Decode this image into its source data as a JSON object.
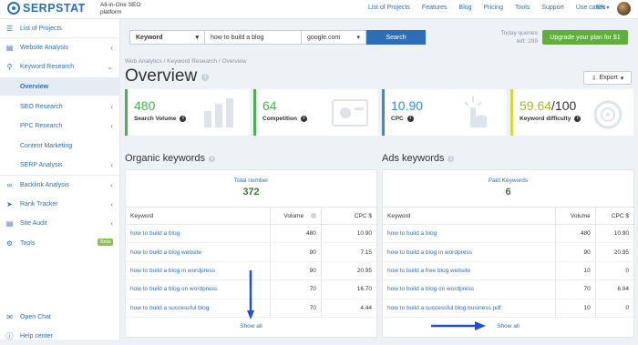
{
  "header": {
    "brand": "SERPSTAT",
    "tagline": "All-in-One SEO platform",
    "nav": [
      "List of Projects",
      "Features",
      "Blog",
      "Pricing",
      "Tools",
      "Support",
      "Use cases"
    ],
    "lang": "EN"
  },
  "sidebar": {
    "items": [
      {
        "label": "List of Projects",
        "icon": "list-icon"
      },
      {
        "label": "Website Analysis",
        "icon": "chart-icon"
      },
      {
        "label": "Keyword Research",
        "icon": "key-icon"
      },
      {
        "label": "Overview"
      },
      {
        "label": "SEO Research"
      },
      {
        "label": "PPC Research"
      },
      {
        "label": "Content Marketing"
      },
      {
        "label": "SERP Analysis"
      },
      {
        "label": "Backlink Analysis",
        "icon": "link-icon"
      },
      {
        "label": "Rank Tracker",
        "icon": "tracker-icon"
      },
      {
        "label": "Site Audit",
        "icon": "audit-icon"
      },
      {
        "label": "Tools",
        "icon": "gear-icon"
      }
    ],
    "beta": "Beta",
    "open_chat": "Open Chat",
    "help_center": "Help center"
  },
  "search": {
    "type": "Keyword",
    "query": "how to build a blog",
    "engine": "google.com",
    "button": "Search",
    "queries_label": "Today queries",
    "queries_left": "left: 299",
    "upgrade": "Upgrade your plan for $1"
  },
  "page": {
    "breadcrumb": "Web Analytics / Keyword Research / Overview",
    "title": "Overview",
    "export": "Export"
  },
  "cards": [
    {
      "value": "480",
      "label": "Search Volume",
      "color": "#4caf50"
    },
    {
      "value": "64",
      "label": "Competition",
      "color": "#4caf50"
    },
    {
      "value": "10.90",
      "label": "CPC",
      "color": "#2d8fd5"
    },
    {
      "value_main": "59.64",
      "value_tail": "/100",
      "label": "Keyword difficulty",
      "color": "#cddc39"
    }
  ],
  "organic": {
    "title": "Organic keywords",
    "total_label": "Total number",
    "total_value": "372",
    "columns": [
      "Keyword",
      "Volume",
      "CPC $"
    ],
    "rows": [
      [
        "how to build a blog",
        "480",
        "10.90"
      ],
      [
        "how to build a blog website",
        "90",
        "7.15"
      ],
      [
        "how to build a blog in wordpress",
        "90",
        "20.95"
      ],
      [
        "how to build a blog on wordpress",
        "70",
        "16.70"
      ],
      [
        "how to build a successful blog",
        "70",
        "4.44"
      ]
    ],
    "show_all": "Show all"
  },
  "ads": {
    "title": "Ads keywords",
    "total_label": "Paid Keywords",
    "total_value": "6",
    "columns": [
      "Keyword",
      "Volume",
      "CPC $"
    ],
    "rows": [
      [
        "how to build a blog",
        "480",
        "10.90"
      ],
      [
        "how to build a blog in wordpress",
        "90",
        "20.95"
      ],
      [
        "how to build a free blog website",
        "10",
        "0"
      ],
      [
        "how to build a blog on wordpress",
        "70",
        "6.04"
      ],
      [
        "how to build a successful blog business pdf",
        "10",
        "0"
      ]
    ],
    "show_all": "Show all"
  }
}
